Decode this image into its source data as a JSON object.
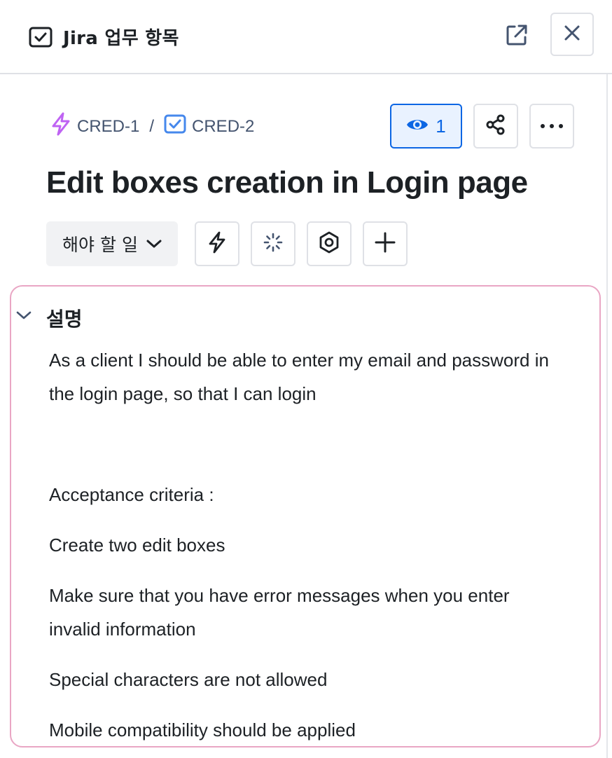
{
  "panel": {
    "title": "Jira 업무 항목",
    "title_icon": "checkbox-icon",
    "actions": {
      "open_external_icon": "open-external-icon",
      "close_icon": "close-icon"
    }
  },
  "breadcrumb": [
    {
      "key": "CRED-1",
      "icon": "lightning-icon",
      "icon_color": "#BF63F3"
    },
    {
      "key": "CRED-2",
      "icon": "task-checkbox-icon",
      "icon_color": "#4688EC"
    }
  ],
  "breadcrumb_separator": "/",
  "toolbar": {
    "watch_count": "1",
    "watch_icon": "eye-icon",
    "share_icon": "share-icon",
    "more_icon": "more-icon"
  },
  "issue": {
    "title": "Edit boxes creation in Login page"
  },
  "actions_row": {
    "status_label": "해야 할 일",
    "buttons": [
      "lightning-icon",
      "loading-spinner-icon",
      "settings-hex-icon",
      "plus-icon"
    ]
  },
  "description": {
    "heading": "설명",
    "paragraphs": [
      "As a client I should be able to enter my email and password in the login page, so that I can login",
      "Acceptance criteria :",
      "Create two edit boxes",
      "Make sure that you have error messages when you enter invalid information",
      "Special characters are not allowed",
      "Mobile compatibility should be applied"
    ]
  },
  "colors": {
    "accent": "#0C66E4",
    "accent_bg": "#E9F2FF",
    "highlight_border": "#E9A6C4",
    "text": "#1D2125",
    "subtle_text": "#44546F",
    "border": "#DFE1E6"
  }
}
